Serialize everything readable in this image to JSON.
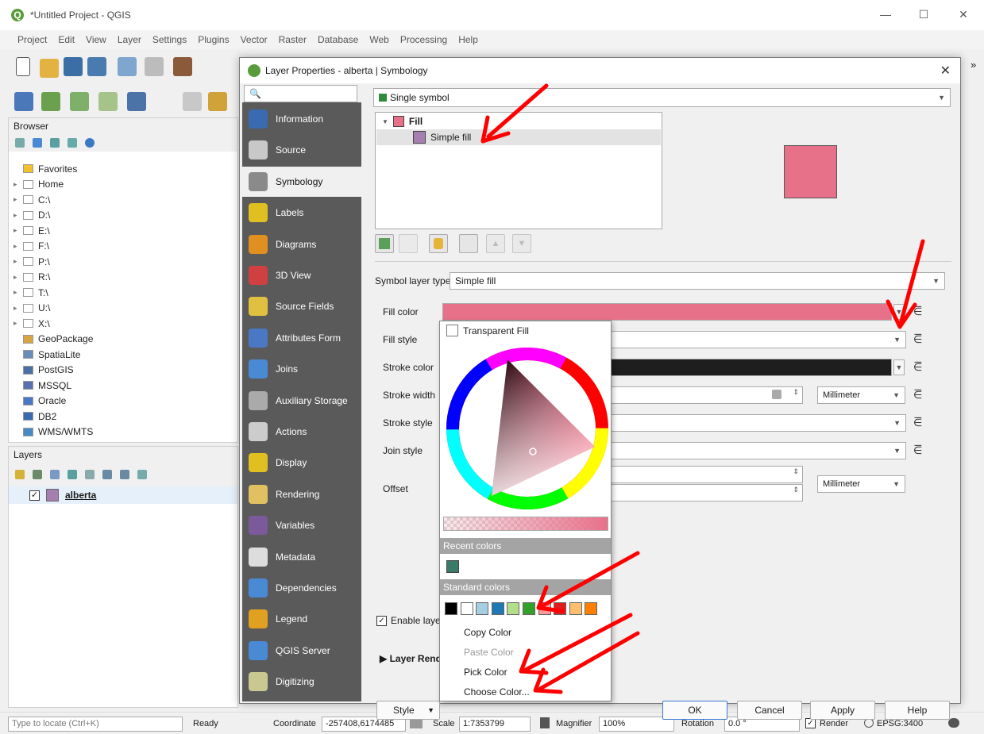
{
  "window": {
    "title": "*Untitled Project - QGIS",
    "minimize": "—",
    "maximize": "☐",
    "close": "✕",
    "overflow": "»"
  },
  "menu": [
    "Project",
    "Edit",
    "View",
    "Layer",
    "Settings",
    "Plugins",
    "Vector",
    "Raster",
    "Database",
    "Web",
    "Processing",
    "Help"
  ],
  "browser": {
    "title": "Browser",
    "items": [
      {
        "label": "Favorites",
        "arrow": "",
        "icon": "star-icon"
      },
      {
        "label": "Home",
        "arrow": "▸",
        "icon": "home-icon"
      },
      {
        "label": "C:\\",
        "arrow": "▸",
        "icon": "drive-icon"
      },
      {
        "label": "D:\\",
        "arrow": "▸",
        "icon": "drive-icon"
      },
      {
        "label": "E:\\",
        "arrow": "▸",
        "icon": "drive-icon"
      },
      {
        "label": "F:\\",
        "arrow": "▸",
        "icon": "drive-icon"
      },
      {
        "label": "P:\\",
        "arrow": "▸",
        "icon": "drive-icon"
      },
      {
        "label": "R:\\",
        "arrow": "▸",
        "icon": "drive-icon"
      },
      {
        "label": "T:\\",
        "arrow": "▸",
        "icon": "drive-icon"
      },
      {
        "label": "U:\\",
        "arrow": "▸",
        "icon": "drive-icon"
      },
      {
        "label": "X:\\",
        "arrow": "▸",
        "icon": "drive-icon"
      },
      {
        "label": "GeoPackage",
        "arrow": "",
        "icon": "geopackage-icon"
      },
      {
        "label": "SpatiaLite",
        "arrow": "",
        "icon": "spatialite-icon"
      },
      {
        "label": "PostGIS",
        "arrow": "",
        "icon": "postgis-icon"
      },
      {
        "label": "MSSQL",
        "arrow": "",
        "icon": "mssql-icon"
      },
      {
        "label": "Oracle",
        "arrow": "",
        "icon": "oracle-icon"
      },
      {
        "label": "DB2",
        "arrow": "",
        "icon": "db2-icon"
      },
      {
        "label": "WMS/WMTS",
        "arrow": "",
        "icon": "wms-icon"
      }
    ]
  },
  "layers": {
    "title": "Layers",
    "layer_name": "alberta",
    "layer_checked": "✓"
  },
  "dialog": {
    "title": "Layer Properties - alberta | Symbology",
    "close": "✕",
    "search_placeholder": "🔍",
    "sidebar": [
      {
        "label": "Information",
        "name": "information"
      },
      {
        "label": "Source",
        "name": "source"
      },
      {
        "label": "Symbology",
        "name": "symbology"
      },
      {
        "label": "Labels",
        "name": "labels"
      },
      {
        "label": "Diagrams",
        "name": "diagrams"
      },
      {
        "label": "3D View",
        "name": "3d-view"
      },
      {
        "label": "Source Fields",
        "name": "source-fields"
      },
      {
        "label": "Attributes Form",
        "name": "attributes-form"
      },
      {
        "label": "Joins",
        "name": "joins"
      },
      {
        "label": "Auxiliary Storage",
        "name": "auxiliary-storage"
      },
      {
        "label": "Actions",
        "name": "actions"
      },
      {
        "label": "Display",
        "name": "display"
      },
      {
        "label": "Rendering",
        "name": "rendering"
      },
      {
        "label": "Variables",
        "name": "variables"
      },
      {
        "label": "Metadata",
        "name": "metadata"
      },
      {
        "label": "Dependencies",
        "name": "dependencies"
      },
      {
        "label": "Legend",
        "name": "legend"
      },
      {
        "label": "QGIS Server",
        "name": "qgis-server"
      },
      {
        "label": "Digitizing",
        "name": "digitizing"
      }
    ],
    "renderer": "Single symbol",
    "tree_fill": "Fill",
    "tree_simple_fill": "Simple fill",
    "symbol_layer_type_label": "Symbol layer type",
    "symbol_layer_type_value": "Simple fill",
    "props": {
      "fill_color": "Fill color",
      "fill_style": "Fill style",
      "stroke_color": "Stroke color",
      "stroke_width": "Stroke width",
      "stroke_style": "Stroke style",
      "join_style": "Join style",
      "offset": "Offset"
    },
    "stroke_width_unit": "Millimeter",
    "offset_unit": "Millimeter",
    "enable_layer": "Enable layer",
    "layer_rendering": "Layer Rendering",
    "style_button": "Style",
    "ok": "OK",
    "cancel": "Cancel",
    "apply": "Apply",
    "help": "Help"
  },
  "color_popup": {
    "transparent_fill": "Transparent Fill",
    "recent_colors": "Recent colors",
    "standard_colors": "Standard colors",
    "copy_color": "Copy Color",
    "paste_color": "Paste Color",
    "pick_color": "Pick Color",
    "choose_color": "Choose Color...",
    "recent_swatch": "#3a7a68",
    "standard_swatches": [
      "#000000",
      "#ffffff",
      "#a6cee3",
      "#1f78b4",
      "#b2df8a",
      "#33a02c",
      "#fb9a99",
      "#e31a1c",
      "#fdbf6f",
      "#ff7f00"
    ]
  },
  "colors": {
    "fill": "#e8718a",
    "layer_swatch": "#a57fb0",
    "annotation_arrow": "#ff0000"
  },
  "status": {
    "locate_placeholder": "Type to locate (Ctrl+K)",
    "ready": "Ready",
    "coordinate_label": "Coordinate",
    "coordinate_value": "-257408,6174485",
    "scale_label": "Scale",
    "scale_value": "1:7353799",
    "magnifier_label": "Magnifier",
    "magnifier_value": "100%",
    "rotation_label": "Rotation",
    "rotation_value": "0.0 °",
    "render_label": "Render",
    "crs": "EPSG:3400"
  }
}
